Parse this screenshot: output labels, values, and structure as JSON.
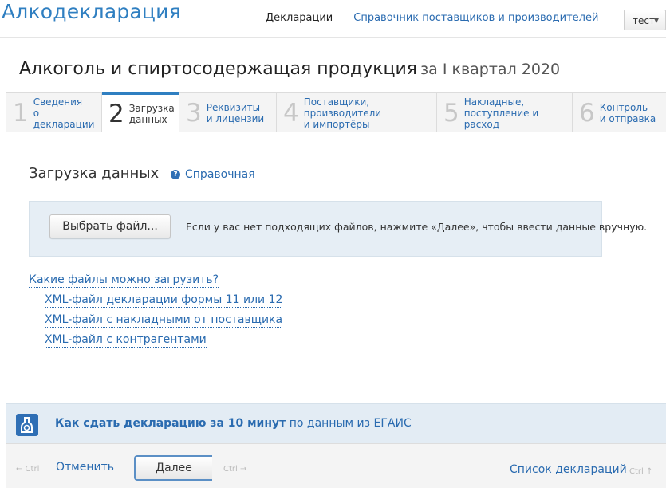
{
  "app": {
    "title": "Алкодекларация"
  },
  "nav": {
    "declarations": "Декларации",
    "directory": "Справочник поставщиков и производителей"
  },
  "user": {
    "name": "тест"
  },
  "page": {
    "title": "Алкоголь и спиртосодержащая продукция",
    "period": "за I квартал 2020"
  },
  "steps": [
    {
      "num": "1",
      "line1": "Сведения",
      "line2": "о декларации",
      "active": false
    },
    {
      "num": "2",
      "line1": "Загрузка",
      "line2": "данных",
      "active": true
    },
    {
      "num": "3",
      "line1": "Реквизиты",
      "line2": "и лицензии",
      "active": false
    },
    {
      "num": "4",
      "line1": "Поставщики, производители",
      "line2": "и импортёры",
      "active": false
    },
    {
      "num": "5",
      "line1": "Накладные,",
      "line2": "поступление и расход",
      "active": false
    },
    {
      "num": "6",
      "line1": "Контроль",
      "line2": "и отправка",
      "active": false
    }
  ],
  "section": {
    "title": "Загрузка данных",
    "help_label": "Справочная",
    "help_icon_glyph": "?"
  },
  "upload": {
    "button_label": "Выбрать файл...",
    "hint": "Если у вас нет подходящих файлов, нажмите «Далее», чтобы ввести данные вручную."
  },
  "files": {
    "question": "Какие файлы можно загрузить?",
    "types": [
      "XML-файл декларации формы 11 или 12",
      "XML-файл с накладными от поставщика",
      "XML-файл с контрагентами"
    ]
  },
  "banner": {
    "bold": "Как сдать декларацию за 10 минут",
    "rest": " по данным из ЕГАИС"
  },
  "footer": {
    "cancel_hint": "← Ctrl",
    "cancel_label": "Отменить",
    "next_label": "Далее",
    "next_hint": "Ctrl →",
    "list_label": "Список деклараций",
    "list_hint": "Ctrl ↑"
  },
  "colors": {
    "accent": "#2f7fc1",
    "link": "#2a6bb0",
    "panel": "#e6eef5"
  }
}
